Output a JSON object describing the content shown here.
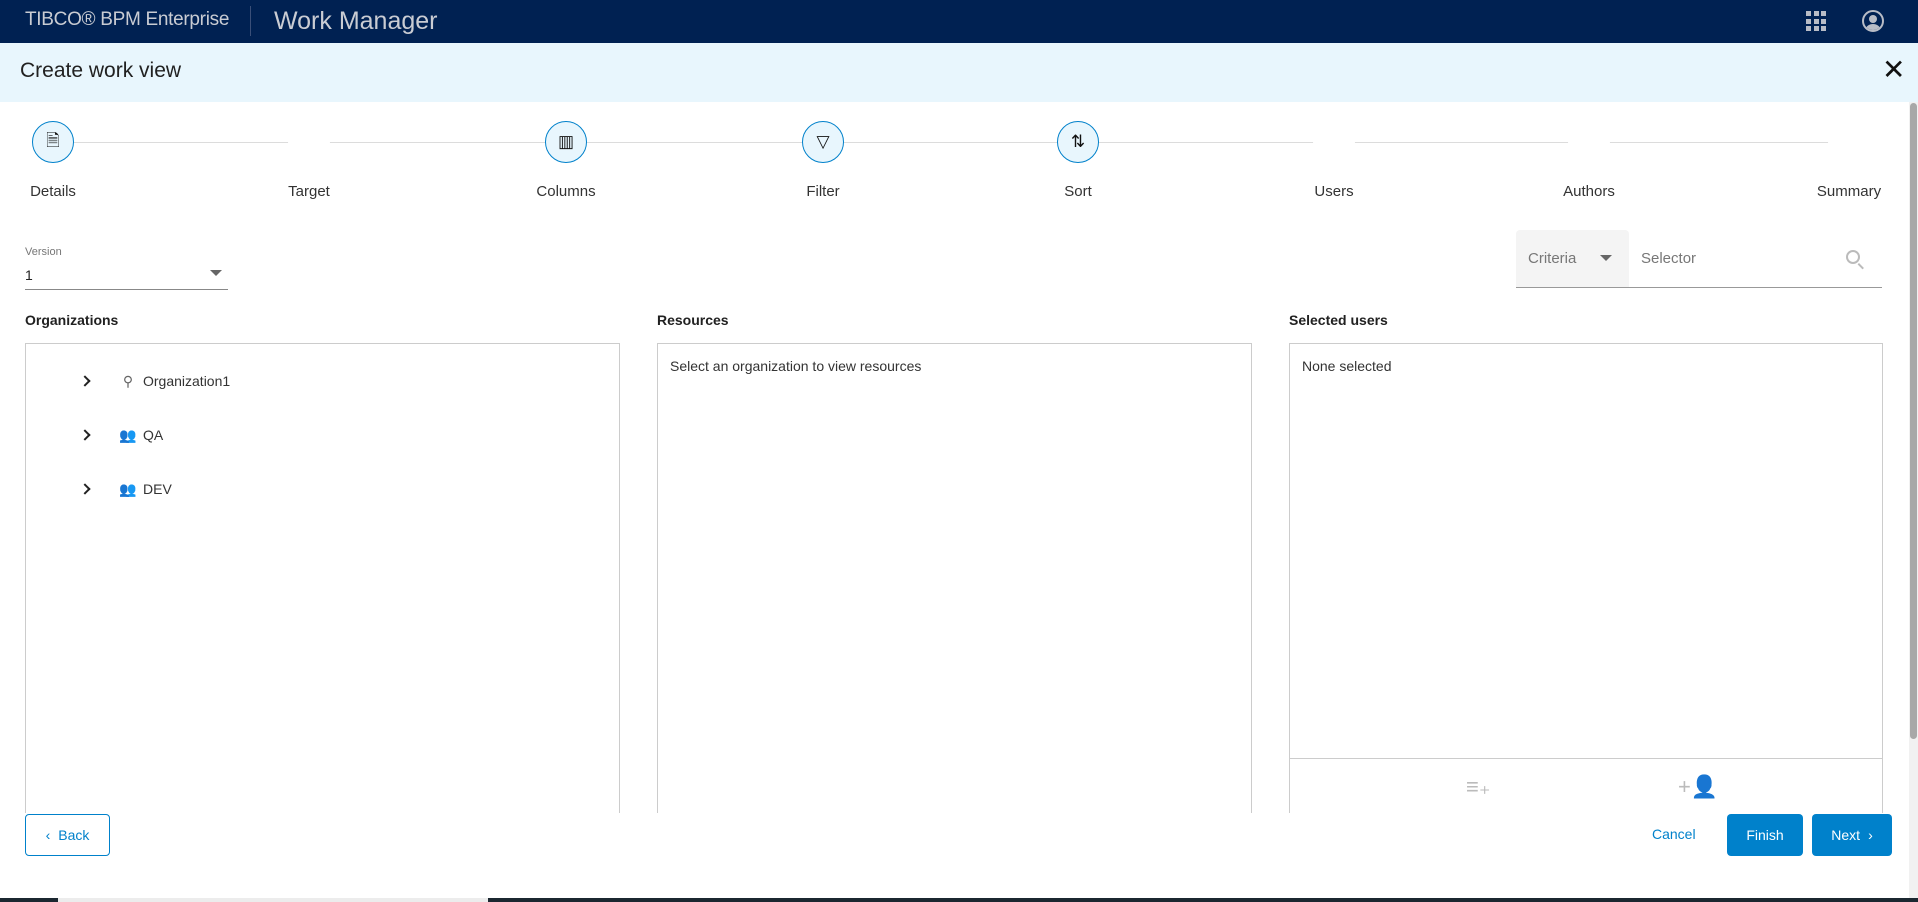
{
  "topbar": {
    "brand": "TIBCO® BPM Enterprise",
    "app_title": "Work Manager",
    "apps_icon": "apps-grid-icon",
    "user_icon": "account-circle-icon"
  },
  "header": {
    "title": "Create work view",
    "close_icon": "close-icon"
  },
  "steps": [
    {
      "label": "Details",
      "state": "done",
      "icon": "document-search-icon"
    },
    {
      "label": "Target",
      "state": "todo",
      "icon": "clipboard-icon"
    },
    {
      "label": "Columns",
      "state": "done",
      "icon": "columns-icon"
    },
    {
      "label": "Filter",
      "state": "done",
      "icon": "filter-icon"
    },
    {
      "label": "Sort",
      "state": "done",
      "icon": "sort-icon"
    },
    {
      "label": "Users",
      "state": "current",
      "icon": "clipboard-icon"
    },
    {
      "label": "Authors",
      "state": "todo",
      "icon": "clipboard-icon"
    },
    {
      "label": "Summary",
      "state": "todo",
      "icon": "clipboard-icon"
    }
  ],
  "version": {
    "label": "Version",
    "value": "1"
  },
  "search": {
    "criteria": "Criteria",
    "selector_placeholder": "Selector"
  },
  "organizations": {
    "title": "Organizations",
    "items": [
      {
        "label": "Organization1",
        "icon": "org-chart-icon"
      },
      {
        "label": "QA",
        "icon": "group-icon"
      },
      {
        "label": "DEV",
        "icon": "group-icon"
      }
    ]
  },
  "resources": {
    "title": "Resources",
    "message": "Select an organization to view resources"
  },
  "selected_users": {
    "title": "Selected users",
    "message": "None selected"
  },
  "footer": {
    "back": "Back",
    "cancel": "Cancel",
    "finish": "Finish",
    "next": "Next"
  },
  "colors": {
    "primary": "#0081cb",
    "topbar": "#002152",
    "header": "#e8f6fd"
  }
}
